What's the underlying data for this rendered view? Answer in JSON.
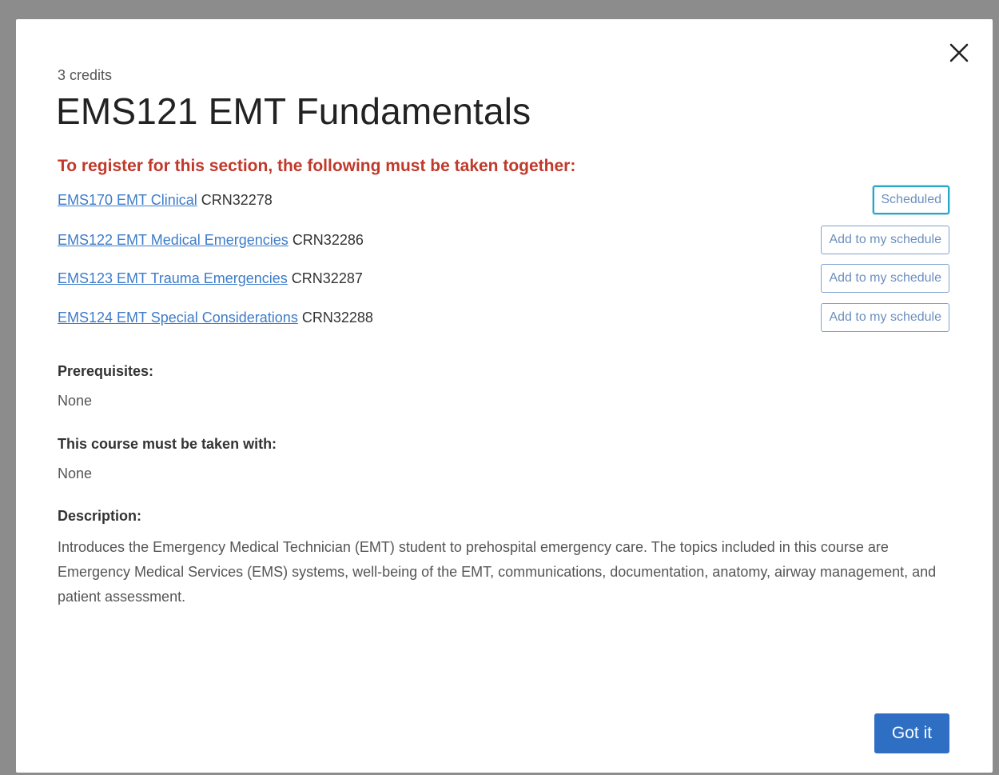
{
  "modal": {
    "credits": "3 credits",
    "title": "EMS121 EMT Fundamentals",
    "close_icon": "close-icon"
  },
  "coreq": {
    "heading": "To register for this section, the following must be taken together:",
    "sections": [
      {
        "course": "EMS170 EMT Clinical",
        "crn": "CRN32278",
        "action": "Scheduled",
        "status": "scheduled"
      },
      {
        "course": "EMS122 EMT Medical Emergencies",
        "crn": "CRN32286",
        "action": "Add to my schedule",
        "status": "not-scheduled"
      },
      {
        "course": "EMS123 EMT Trauma Emergencies",
        "crn": "CRN32287",
        "action": "Add to my schedule",
        "status": "not-scheduled"
      },
      {
        "course": "EMS124 EMT Special Considerations",
        "crn": "CRN32288",
        "action": "Add to my schedule",
        "status": "not-scheduled"
      }
    ]
  },
  "details": {
    "prereq_label": "Prerequisites:",
    "prereq_value": "None",
    "with_label": "This course must be taken with:",
    "with_value": "None",
    "desc_label": "Description:",
    "desc_value": "Introduces the Emergency Medical Technician (EMT) student to prehospital emergency care. The topics included in this course are Emergency Medical Services (EMS) systems, well-being of the EMT, communications, documentation, anatomy, airway management, and patient assessment."
  },
  "footer": {
    "confirm_label": "Got it"
  },
  "colors": {
    "heading_warning": "#c0392b",
    "link": "#3d7cc9",
    "primary_button": "#2e6fc4",
    "scheduled_border": "#26a6c6"
  }
}
